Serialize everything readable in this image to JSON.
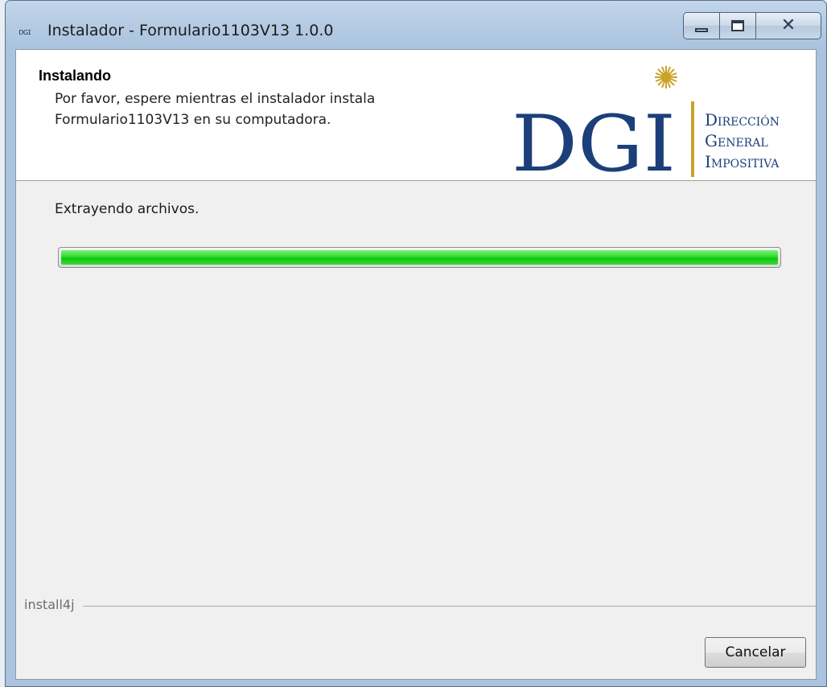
{
  "window": {
    "app_icon_text": "ᴅɢɪ",
    "title": "Instalador - Formulario1103V13 1.0.0",
    "minimize_icon": "minimize-icon",
    "maximize_icon": "maximize-icon",
    "close_icon": "close-icon"
  },
  "header": {
    "title": "Instalando",
    "description_line1": "Por favor, espere mientras el instalador instala",
    "description_line2": "Formulario1103V13 en su computadora.",
    "logo": {
      "letters": "DGI",
      "line1": "Dirección",
      "line2": "General",
      "line3": "Impositiva"
    }
  },
  "main": {
    "status": "Extrayendo archivos.",
    "progress": 1.0
  },
  "footer": {
    "brand": "install4j",
    "cancel_label": "Cancelar"
  },
  "colors": {
    "progress_green": "#22d022",
    "logo_blue": "#1c3f7a",
    "logo_gold": "#c9a227"
  }
}
